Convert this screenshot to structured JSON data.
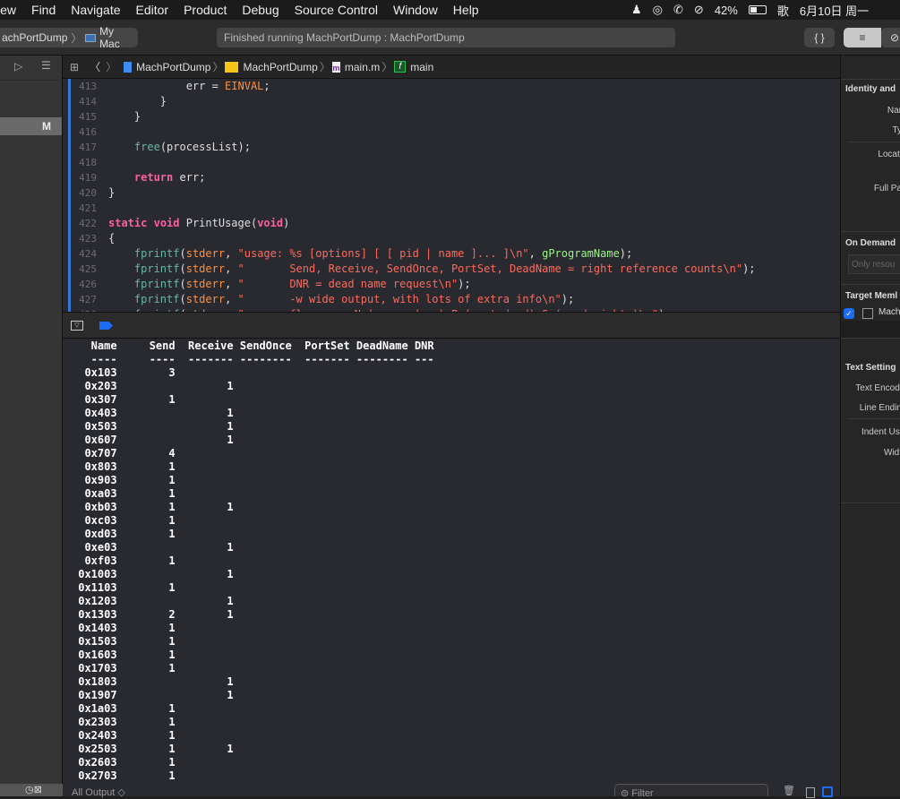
{
  "menubar": {
    "items": [
      "iew",
      "Find",
      "Navigate",
      "Editor",
      "Product",
      "Debug",
      "Source Control",
      "Window",
      "Help"
    ],
    "battery": "42%",
    "ime": "歌",
    "date": "6月10日 周一"
  },
  "toolbar": {
    "scheme": "achPortDump",
    "destination": "My Mac",
    "status": "Finished running MachPortDump : MachPortDump",
    "braces": "{ }"
  },
  "navigator": {
    "selected_badge": "M"
  },
  "jumpbar": {
    "items": [
      "MachPortDump",
      "MachPortDump",
      "main.m",
      "main"
    ]
  },
  "editor": {
    "lines": [
      {
        "n": "413",
        "t": [
          [
            "            err = ",
            ""
          ],
          [
            "EINVAL",
            "mc"
          ],
          [
            ";",
            ""
          ]
        ]
      },
      {
        "n": "414",
        "t": [
          [
            "        }",
            ""
          ]
        ]
      },
      {
        "n": "415",
        "t": [
          [
            "    }",
            ""
          ]
        ]
      },
      {
        "n": "416",
        "t": []
      },
      {
        "n": "417",
        "t": [
          [
            "    ",
            ""
          ],
          [
            "free",
            "fn"
          ],
          [
            "(processList);",
            ""
          ]
        ]
      },
      {
        "n": "418",
        "t": []
      },
      {
        "n": "419",
        "t": [
          [
            "    ",
            ""
          ],
          [
            "return",
            "kw"
          ],
          [
            " err;",
            ""
          ]
        ]
      },
      {
        "n": "420",
        "t": [
          [
            "}",
            ""
          ]
        ]
      },
      {
        "n": "421",
        "t": []
      },
      {
        "n": "422",
        "t": [
          [
            "static",
            "kw"
          ],
          [
            " ",
            ""
          ],
          [
            "void",
            "kw"
          ],
          [
            " PrintUsage(",
            ""
          ],
          [
            "void",
            "kw"
          ],
          [
            ")",
            ""
          ]
        ]
      },
      {
        "n": "423",
        "t": [
          [
            "{",
            ""
          ]
        ]
      },
      {
        "n": "424",
        "t": [
          [
            "    ",
            ""
          ],
          [
            "fprintf",
            "fn"
          ],
          [
            "(",
            ""
          ],
          [
            "stderr",
            "mc"
          ],
          [
            ", ",
            ""
          ],
          [
            "\"usage: %s [options] [ [ pid | name ]... ]\\n\"",
            "st"
          ],
          [
            ", ",
            ""
          ],
          [
            "gProgramName",
            "gl"
          ],
          [
            ");",
            ""
          ]
        ]
      },
      {
        "n": "425",
        "t": [
          [
            "    ",
            ""
          ],
          [
            "fprintf",
            "fn"
          ],
          [
            "(",
            ""
          ],
          [
            "stderr",
            "mc"
          ],
          [
            ", ",
            ""
          ],
          [
            "\"       Send, Receive, SendOnce, PortSet, DeadName = right reference counts\\n\"",
            "st"
          ],
          [
            ");",
            ""
          ]
        ]
      },
      {
        "n": "426",
        "t": [
          [
            "    ",
            ""
          ],
          [
            "fprintf",
            "fn"
          ],
          [
            "(",
            ""
          ],
          [
            "stderr",
            "mc"
          ],
          [
            ", ",
            ""
          ],
          [
            "\"       DNR = dead name request\\n\"",
            "st"
          ],
          [
            ");",
            ""
          ]
        ]
      },
      {
        "n": "427",
        "t": [
          [
            "    ",
            ""
          ],
          [
            "fprintf",
            "fn"
          ],
          [
            "(",
            ""
          ],
          [
            "stderr",
            "mc"
          ],
          [
            ", ",
            ""
          ],
          [
            "\"       -w wide output, with lots of extra info\\n\"",
            "st"
          ],
          [
            ");",
            ""
          ]
        ]
      },
      {
        "n": "428",
        "t": [
          [
            "    ",
            ""
          ],
          [
            "fprintf",
            "fn"
          ],
          [
            "(",
            ""
          ],
          [
            "stderr",
            "mc"
          ],
          [
            ", ",
            ""
          ],
          [
            "\"       flg     = N (no-senders) P (port-dead) S (send-rights)\\n\"",
            "st"
          ],
          [
            ");",
            ""
          ]
        ]
      }
    ]
  },
  "console": {
    "headers": [
      "Name",
      "Send",
      "Receive",
      "SendOnce",
      "PortSet",
      "DeadName",
      "DNR"
    ],
    "dashes": [
      "----",
      "----",
      "-------",
      "--------",
      "-------",
      "--------",
      "---"
    ],
    "rows": [
      [
        "0x103",
        "3",
        ""
      ],
      [
        "0x203",
        "",
        "1"
      ],
      [
        "0x307",
        "1",
        ""
      ],
      [
        "0x403",
        "",
        "1"
      ],
      [
        "0x503",
        "",
        "1"
      ],
      [
        "0x607",
        "",
        "1"
      ],
      [
        "0x707",
        "4",
        ""
      ],
      [
        "0x803",
        "1",
        ""
      ],
      [
        "0x903",
        "1",
        ""
      ],
      [
        "0xa03",
        "1",
        ""
      ],
      [
        "0xb03",
        "1",
        "1"
      ],
      [
        "0xc03",
        "1",
        ""
      ],
      [
        "0xd03",
        "1",
        ""
      ],
      [
        "0xe03",
        "",
        "1"
      ],
      [
        "0xf03",
        "1",
        ""
      ],
      [
        "0x1003",
        "",
        "1"
      ],
      [
        "0x1103",
        "1",
        ""
      ],
      [
        "0x1203",
        "",
        "1"
      ],
      [
        "0x1303",
        "2",
        "1"
      ],
      [
        "0x1403",
        "1",
        ""
      ],
      [
        "0x1503",
        "1",
        ""
      ],
      [
        "0x1603",
        "1",
        ""
      ],
      [
        "0x1703",
        "1",
        ""
      ],
      [
        "0x1803",
        "",
        "1"
      ],
      [
        "0x1907",
        "",
        "1"
      ],
      [
        "0x1a03",
        "1",
        ""
      ],
      [
        "0x2303",
        "1",
        ""
      ],
      [
        "0x2403",
        "1",
        ""
      ],
      [
        "0x2503",
        "1",
        "1"
      ],
      [
        "0x2603",
        "1",
        ""
      ],
      [
        "0x2703",
        "1",
        ""
      ]
    ],
    "output_selector": "All Output ◇",
    "filter_placeholder": "Filter"
  },
  "inspector": {
    "identity": "Identity and",
    "name": "Nar",
    "type": "Ty",
    "location": "Locati",
    "full_path": "Full Pa",
    "on_demand": "On Demand",
    "only_resources": "Only resou",
    "target": "Target Meml",
    "target_item": "Mach",
    "target_checked": true,
    "text_settings": "Text Setting",
    "encoding": "Text Encodi",
    "line_endings": "Line Endin",
    "indent": "Indent Usi",
    "width": "Widt"
  },
  "colors": {
    "accent": "#3576d4",
    "keyword": "#fc5fa3",
    "string": "#fc6a5d",
    "function": "#67b7a4"
  }
}
